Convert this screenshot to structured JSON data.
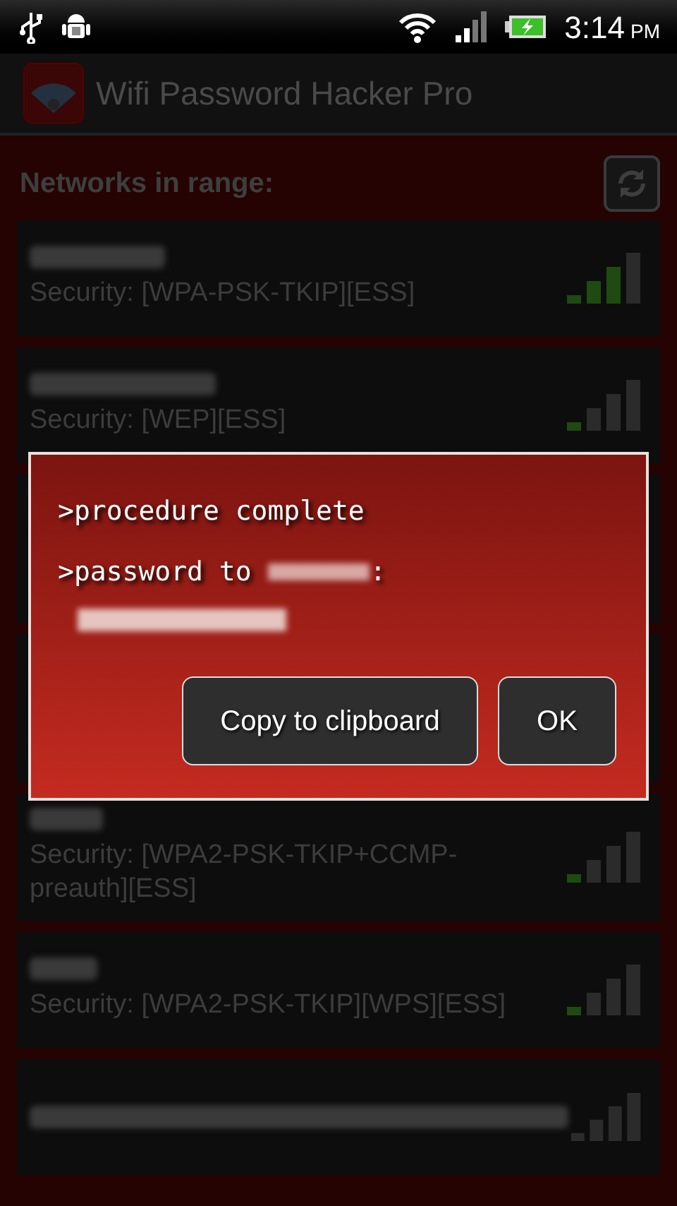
{
  "status_bar": {
    "time": "3:14",
    "ampm": "PM"
  },
  "app_bar": {
    "title": "Wifi Password Hacker Pro"
  },
  "header": {
    "title": "Networks in range:"
  },
  "networks": [
    {
      "kind": "strong",
      "security": "Security: [WPA-PSK-TKIP][ESS]"
    },
    {
      "kind": "weak",
      "security": "Security: [WEP][ESS]"
    },
    {
      "kind": "hidden"
    },
    {
      "kind": "hidden"
    },
    {
      "kind": "weak",
      "security": "Security: [WPA2-PSK-TKIP+CCMP-preauth][ESS]"
    },
    {
      "kind": "weak",
      "security": "Security: [WPA2-PSK-TKIP][WPS][ESS]"
    },
    {
      "kind": "faint"
    }
  ],
  "dialog": {
    "line_1": ">procedure complete",
    "line_2_prefix": ">password to",
    "line_2_suffix": ":",
    "buttons": [
      {
        "label": "Copy to clipboard"
      },
      {
        "label": "OK"
      }
    ]
  }
}
